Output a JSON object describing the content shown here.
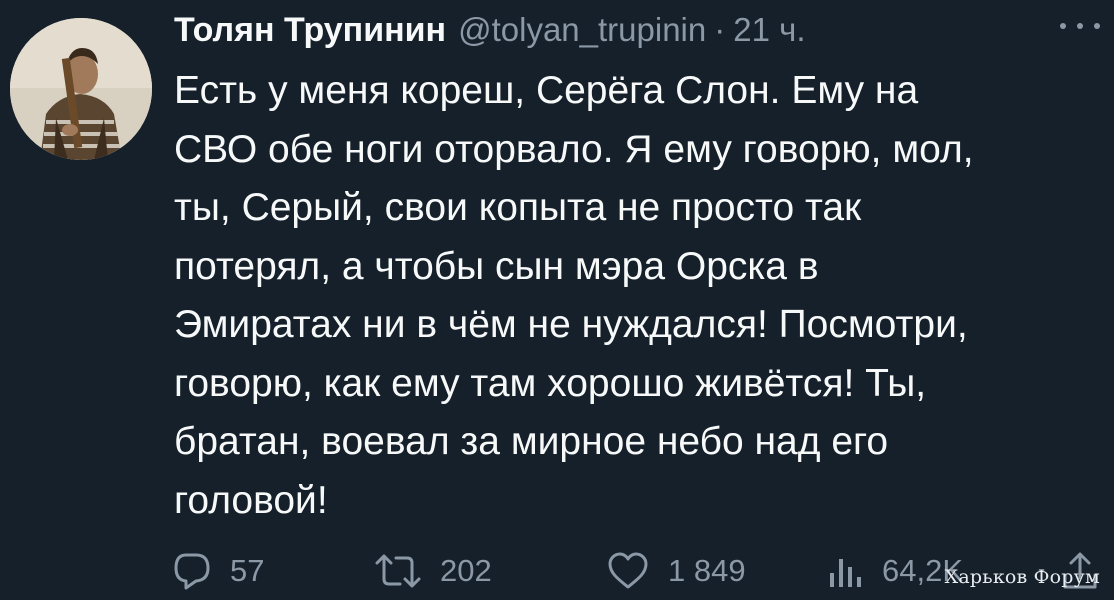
{
  "author": {
    "display_name": "Толян Трупинин",
    "handle": "@tolyan_trupinin",
    "separator": "·",
    "time": "21 ч."
  },
  "tweet": {
    "lines": [
      "Есть у меня кореш, Серёга Слон.  Ему на",
      "СВО обе ноги оторвало. Я ему говорю, мол,",
      "ты, Серый, свои копыта не просто так",
      "потерял, а чтобы сын мэра Орска в",
      "Эмиратах ни в чём не нуждался! Посмотри,",
      "говорю, как ему там хорошо живётся! Ты,",
      "братан, воевал за мирное небо над его",
      "головой!"
    ]
  },
  "actions": {
    "replies": "57",
    "retweets": "202",
    "likes": "1 849",
    "views": "64,2K",
    "icons": [
      "reply-icon",
      "retweet-icon",
      "like-icon",
      "views-icon",
      "share-icon"
    ]
  },
  "watermark": "Харьков Форум",
  "colors": {
    "background": "#15202b",
    "text": "#f7f9f9",
    "secondary": "#8b98a5"
  }
}
